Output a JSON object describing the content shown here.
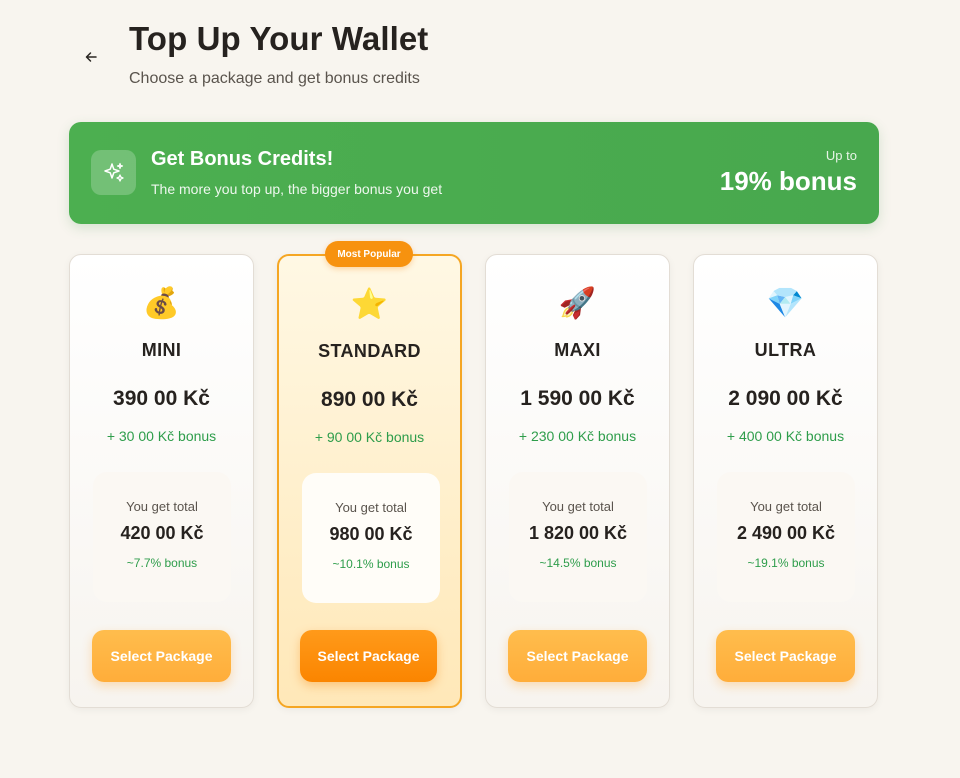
{
  "header": {
    "title": "Top Up Your Wallet",
    "subtitle": "Choose a package and get bonus credits"
  },
  "banner": {
    "title": "Get Bonus Credits!",
    "subtitle": "The more you top up, the bigger bonus you get",
    "up_to_label": "Up to",
    "max_bonus": "19% bonus",
    "icon": "sparkles-icon",
    "color": "#4caf50"
  },
  "badge": {
    "label": "Most Popular"
  },
  "packages": [
    {
      "emoji": "💰",
      "name": "MINI",
      "price": "390 00 Kč",
      "bonus": "+ 30 00 Kč bonus",
      "total_label": "You get total",
      "total": "420 00 Kč",
      "bonus_pct": "~7.7% bonus",
      "button": "Select Package"
    },
    {
      "emoji": "⭐",
      "name": "STANDARD",
      "price": "890 00 Kč",
      "bonus": "+ 90 00 Kč bonus",
      "total_label": "You get total",
      "total": "980 00 Kč",
      "bonus_pct": "~10.1% bonus",
      "button": "Select Package"
    },
    {
      "emoji": "🚀",
      "name": "MAXI",
      "price": "1 590 00 Kč",
      "bonus": "+ 230 00 Kč bonus",
      "total_label": "You get total",
      "total": "1 820 00 Kč",
      "bonus_pct": "~14.5% bonus",
      "button": "Select Package"
    },
    {
      "emoji": "💎",
      "name": "ULTRA",
      "price": "2 090 00 Kč",
      "bonus": "+ 400 00 Kč bonus",
      "total_label": "You get total",
      "total": "2 490 00 Kč",
      "bonus_pct": "~19.1% bonus",
      "button": "Select Package"
    }
  ],
  "colors": {
    "accent": "#f7920f",
    "bonus_green": "#2e9d4b",
    "background": "#f8f5ef"
  }
}
